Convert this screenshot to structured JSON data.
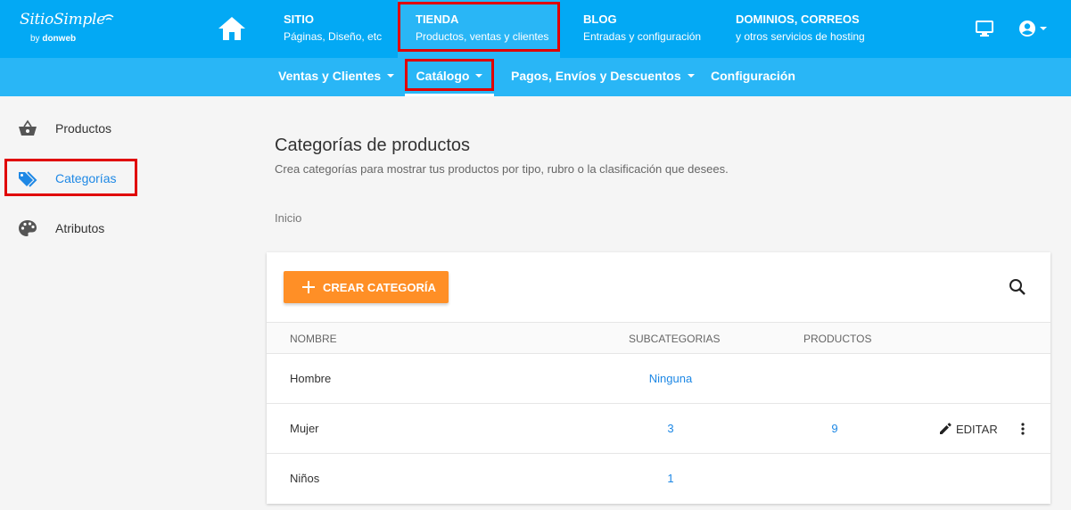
{
  "brand": {
    "name": "SitioSimple",
    "by_prefix": "by",
    "by_brand": "donweb"
  },
  "topnav": [
    {
      "title": "SITIO",
      "subtitle": "Páginas, Diseño, etc"
    },
    {
      "title": "TIENDA",
      "subtitle": "Productos, ventas y clientes",
      "active": true
    },
    {
      "title": "BLOG",
      "subtitle": "Entradas y configuración"
    },
    {
      "title": "DOMINIOS, CORREOS",
      "subtitle": "y otros servicios de hosting"
    }
  ],
  "subnav": [
    {
      "label": "Ventas y Clientes",
      "dropdown": true
    },
    {
      "label": "Catálogo",
      "dropdown": true,
      "active": true
    },
    {
      "label": "Pagos, Envíos y Descuentos",
      "dropdown": true
    },
    {
      "label": "Configuración",
      "dropdown": false
    }
  ],
  "sidebar": [
    {
      "label": "Productos",
      "icon": "basket-icon"
    },
    {
      "label": "Categorías",
      "icon": "tags-icon",
      "active": true
    },
    {
      "label": "Atributos",
      "icon": "palette-icon"
    }
  ],
  "page": {
    "title": "Categorías de productos",
    "description": "Crea categorías para mostrar tus productos por tipo, rubro o la clasificación que desees.",
    "breadcrumb": "Inicio"
  },
  "toolbar": {
    "create_label": "CREAR CATEGORÍA"
  },
  "table": {
    "columns": [
      "NOMBRE",
      "SUBCATEGORIAS",
      "PRODUCTOS"
    ],
    "rows": [
      {
        "name": "Hombre",
        "subcategories": "Ninguna",
        "products": ""
      },
      {
        "name": "Mujer",
        "subcategories": "3",
        "products": "9",
        "edit_label": "EDITAR"
      },
      {
        "name": "Niños",
        "subcategories": "1",
        "products": ""
      }
    ]
  },
  "colors": {
    "topbar": "#03a9f4",
    "subbar": "#29b6f6",
    "accent_orange": "#ff8f26",
    "link_blue": "#1e88e5",
    "highlight_red": "#e00000"
  }
}
